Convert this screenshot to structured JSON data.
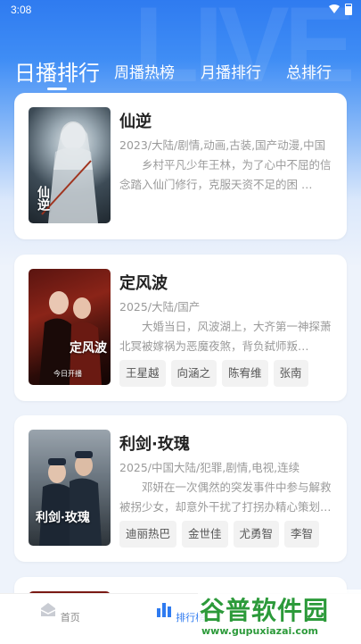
{
  "status_bar": {
    "time": "3:08"
  },
  "tabs": [
    {
      "label": "日播排行"
    },
    {
      "label": "周播热榜"
    },
    {
      "label": "月播排行"
    },
    {
      "label": "总排行"
    }
  ],
  "items": [
    {
      "title": "仙逆",
      "meta": "2023/大陆/剧情,动画,古装,国产动漫,中国",
      "desc": "乡村平凡少年王林，为了心中不屈的信念踏入仙门修行，克服天资不足的困 …",
      "poster_text": "仙逆",
      "tags": []
    },
    {
      "title": "定风波",
      "meta": "2025/大陆/国产",
      "desc": "大婚当日，风波湖上，大齐第一神探萧北冥被嫁祸为恶魔夜煞，背负弑师叛…",
      "poster_text": "定风波",
      "poster_sub": "今日开播",
      "tags": [
        "王星越",
        "向涵之",
        "陈宥维",
        "张南"
      ]
    },
    {
      "title": "利剑·玫瑰",
      "meta": "2025/中国大陆/犯罪,剧情,电视,连续",
      "desc": "邓妍在一次偶然的突发事件中参与解救被拐少女，却意外干扰了打拐办精心策划…",
      "poster_text": "利剑·玫瑰",
      "tags": [
        "迪丽热巴",
        "金世佳",
        "尤勇智",
        "李智"
      ]
    }
  ],
  "bottom_nav": [
    {
      "label": "首页",
      "icon": "home-icon"
    },
    {
      "label": "排行榜",
      "icon": "ranking-icon"
    }
  ],
  "watermark": {
    "title": "谷普软件园",
    "url": "www.gupuxiazai.com"
  },
  "colors": {
    "accent": "#2f7bf0",
    "watermark": "#2c9a3a"
  }
}
